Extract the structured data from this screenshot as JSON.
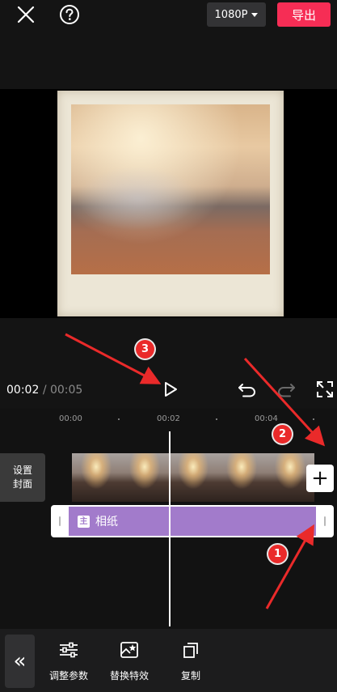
{
  "header": {
    "resolution_label": "1080P",
    "export_label": "导出"
  },
  "playback": {
    "current_time": "00:02",
    "separator": "/",
    "total_time": "00:05"
  },
  "ruler": {
    "ticks": [
      "00:00",
      "00:02",
      "00:04"
    ]
  },
  "timeline": {
    "cover_label_line1": "设置",
    "cover_label_line2": "封面",
    "add_label": "+",
    "effect_badge": "主",
    "effect_name": "相纸"
  },
  "toolbar": {
    "collapse_label": "«",
    "items": [
      {
        "label": "调整参数",
        "icon": "sliders-icon"
      },
      {
        "label": "替换特效",
        "icon": "replace-effect-icon"
      },
      {
        "label": "复制",
        "icon": "copy-icon"
      }
    ]
  },
  "annotations": {
    "markers": [
      "1",
      "2",
      "3"
    ],
    "color": "#ea2a2a"
  },
  "colors": {
    "accent": "#f62d55",
    "effect_track": "#a27bcb"
  }
}
